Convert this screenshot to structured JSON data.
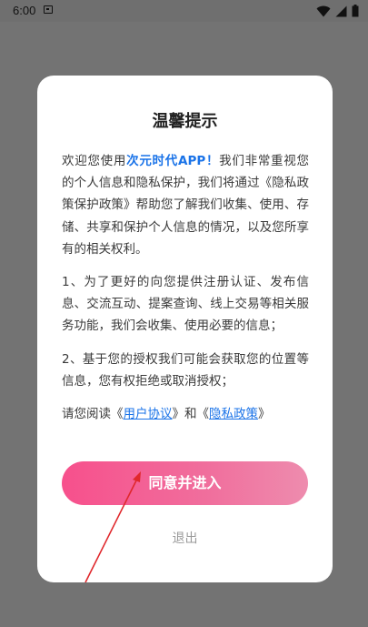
{
  "status_bar": {
    "time": "6:00",
    "icons": [
      "notification-icon",
      "wifi-icon",
      "signal-icon",
      "battery-icon"
    ]
  },
  "dialog": {
    "title": "温馨提示",
    "intro": {
      "prefix": "欢迎您使用",
      "app_name": "次元时代APP！",
      "suffix": "我们非常重视您的个人信息和隐私保护，我们将通过《隐私政策保护政策》帮助您了解我们收集、使用、存储、共享和保护个人信息的情况，以及您所享有的相关权利。"
    },
    "clause_1": "1、为了更好的向您提供注册认证、发布信息、交流互动、提案查询、线上交易等相关服务功能，我们会收集、使用必要的信息；",
    "clause_2": "2、基于您的授权我们可能会获取您的位置等信息，您有权拒绝或取消授权；",
    "read_line": {
      "prefix": "请您阅读《",
      "user_agreement": "用户协议",
      "middle": "》和《",
      "privacy_policy": "隐私政策",
      "suffix": "》"
    },
    "agree_button": "同意并进入",
    "exit_button": "退出"
  },
  "colors": {
    "overlay": "#737373",
    "dialog_bg": "#ffffff",
    "link": "#1a73e8",
    "button_gradient_start": "#f7508c",
    "button_gradient_end": "#ee8cae",
    "annotation_arrow": "#e0282c"
  }
}
